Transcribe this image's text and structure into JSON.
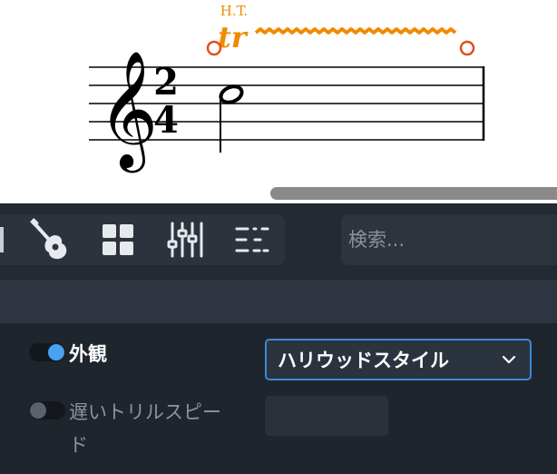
{
  "score": {
    "ornament_label": "H.T.",
    "trill_symbol": "tr",
    "time_signature": {
      "numerator": "2",
      "denominator": "4"
    }
  },
  "toolbar": {
    "tools": [
      {
        "name": "guitar-icon"
      },
      {
        "name": "grid-icon"
      },
      {
        "name": "mixer-icon"
      },
      {
        "name": "list-icon"
      }
    ],
    "search": {
      "placeholder": "検索..."
    }
  },
  "properties": {
    "appearance": {
      "label": "外観",
      "enabled": true,
      "selected": "ハリウッドスタイル"
    },
    "slow_trill": {
      "label_line1": "遅いトリルスピー",
      "label_line2": "ド",
      "enabled": false,
      "value": ""
    }
  },
  "colors": {
    "accent_blue": "#3d8ad8",
    "toggle_on": "#4aa3f0",
    "toggle_off": "#5a616b",
    "ornament_orange": "#f08a00",
    "handle_red": "#e0501e"
  }
}
